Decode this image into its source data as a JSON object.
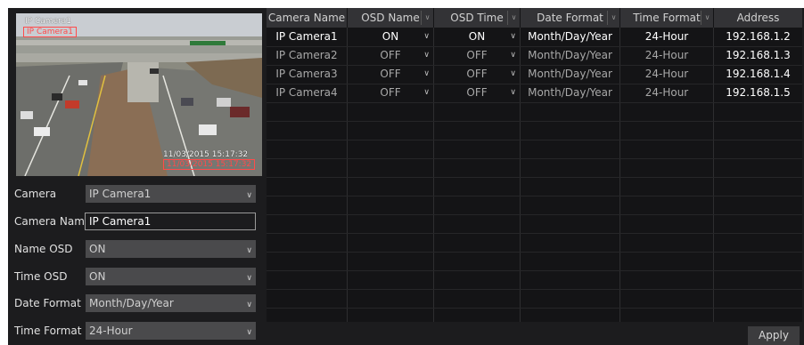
{
  "preview": {
    "osd_name": "IP Camera1",
    "osd_time": "11/03/2015 15:17:32"
  },
  "form": {
    "camera": {
      "label": "Camera",
      "value": "IP Camera1"
    },
    "camera_name": {
      "label": "Camera Name",
      "value": "IP Camera1"
    },
    "name_osd": {
      "label": "Name OSD",
      "value": "ON"
    },
    "time_osd": {
      "label": "Time OSD",
      "value": "ON"
    },
    "date_format": {
      "label": "Date Format",
      "value": "Month/Day/Year"
    },
    "time_format": {
      "label": "Time Format",
      "value": "24-Hour"
    }
  },
  "table": {
    "headers": [
      "Camera Name",
      "OSD Name",
      "OSD Time",
      "Date Format",
      "Time Format",
      "Address"
    ],
    "rows": [
      {
        "camera": "IP Camera1",
        "osd_name": "ON",
        "osd_time": "ON",
        "date_format": "Month/Day/Year",
        "time_format": "24-Hour",
        "address": "192.168.1.2"
      },
      {
        "camera": "IP Camera2",
        "osd_name": "OFF",
        "osd_time": "OFF",
        "date_format": "Month/Day/Year",
        "time_format": "24-Hour",
        "address": "192.168.1.3"
      },
      {
        "camera": "IP Camera3",
        "osd_name": "OFF",
        "osd_time": "OFF",
        "date_format": "Month/Day/Year",
        "time_format": "24-Hour",
        "address": "192.168.1.4"
      },
      {
        "camera": "IP Camera4",
        "osd_name": "OFF",
        "osd_time": "OFF",
        "date_format": "Month/Day/Year",
        "time_format": "24-Hour",
        "address": "192.168.1.5"
      }
    ]
  },
  "apply_label": "Apply",
  "icons": {
    "dropdown": "chevron-down-icon"
  }
}
